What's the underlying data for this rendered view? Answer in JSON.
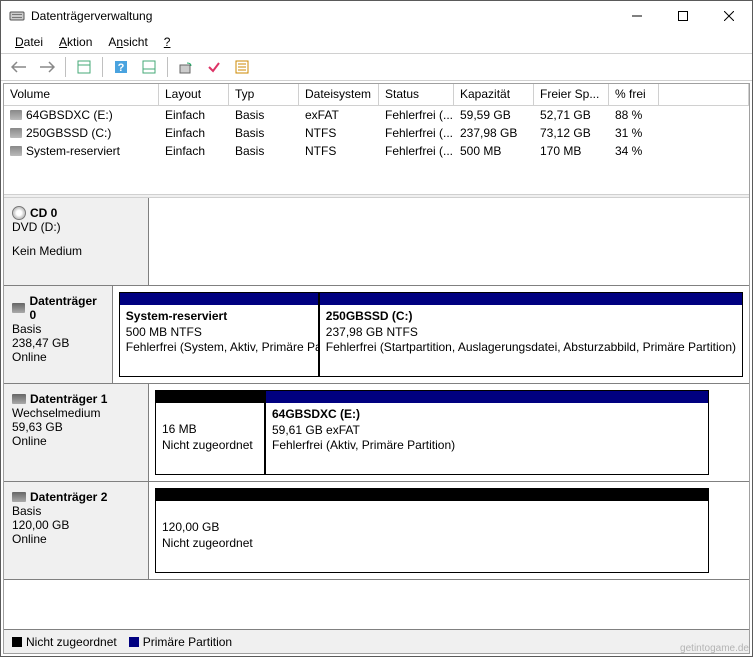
{
  "title": "Datenträgerverwaltung",
  "menu": {
    "datei": "Datei",
    "aktion": "Aktion",
    "ansicht": "Ansicht",
    "help": "?"
  },
  "columns": {
    "volume": "Volume",
    "layout": "Layout",
    "typ": "Typ",
    "fs": "Dateisystem",
    "status": "Status",
    "kapazitaet": "Kapazität",
    "freier": "Freier Sp...",
    "pfrei": "% frei"
  },
  "volumes": [
    {
      "name": "64GBSDXC (E:)",
      "layout": "Einfach",
      "typ": "Basis",
      "fs": "exFAT",
      "status": "Fehlerfrei (...",
      "kap": "59,59 GB",
      "frei": "52,71 GB",
      "p": "88 %"
    },
    {
      "name": "250GBSSD (C:)",
      "layout": "Einfach",
      "typ": "Basis",
      "fs": "NTFS",
      "status": "Fehlerfrei (...",
      "kap": "237,98 GB",
      "frei": "73,12 GB",
      "p": "31 %"
    },
    {
      "name": "System-reserviert",
      "layout": "Einfach",
      "typ": "Basis",
      "fs": "NTFS",
      "status": "Fehlerfrei (...",
      "kap": "500 MB",
      "frei": "170 MB",
      "p": "34 %"
    }
  ],
  "cd": {
    "name": "CD 0",
    "line1": "DVD (D:)",
    "line2": "Kein Medium"
  },
  "disk0": {
    "name": "Datenträger 0",
    "type": "Basis",
    "size": "238,47 GB",
    "state": "Online",
    "p1": {
      "title": "System-reserviert",
      "size": "500 MB NTFS",
      "status": "Fehlerfrei (System, Aktiv, Primäre Pa"
    },
    "p2": {
      "title": "250GBSSD  (C:)",
      "size": "237,98 GB NTFS",
      "status": "Fehlerfrei (Startpartition, Auslagerungsdatei, Absturzabbild, Primäre Partition)"
    }
  },
  "disk1": {
    "name": "Datenträger 1",
    "type": "Wechselmedium",
    "size": "59,63 GB",
    "state": "Online",
    "p1": {
      "size": "16 MB",
      "status": "Nicht zugeordnet"
    },
    "p2": {
      "title": "64GBSDXC  (E:)",
      "size": "59,61 GB exFAT",
      "status": "Fehlerfrei (Aktiv, Primäre Partition)"
    }
  },
  "disk2": {
    "name": "Datenträger 2",
    "type": "Basis",
    "size": "120,00 GB",
    "state": "Online",
    "p1": {
      "size": "120,00 GB",
      "status": "Nicht zugeordnet"
    }
  },
  "legend": {
    "unalloc": "Nicht zugeordnet",
    "primary": "Primäre Partition"
  },
  "watermark": "getintogame.de"
}
